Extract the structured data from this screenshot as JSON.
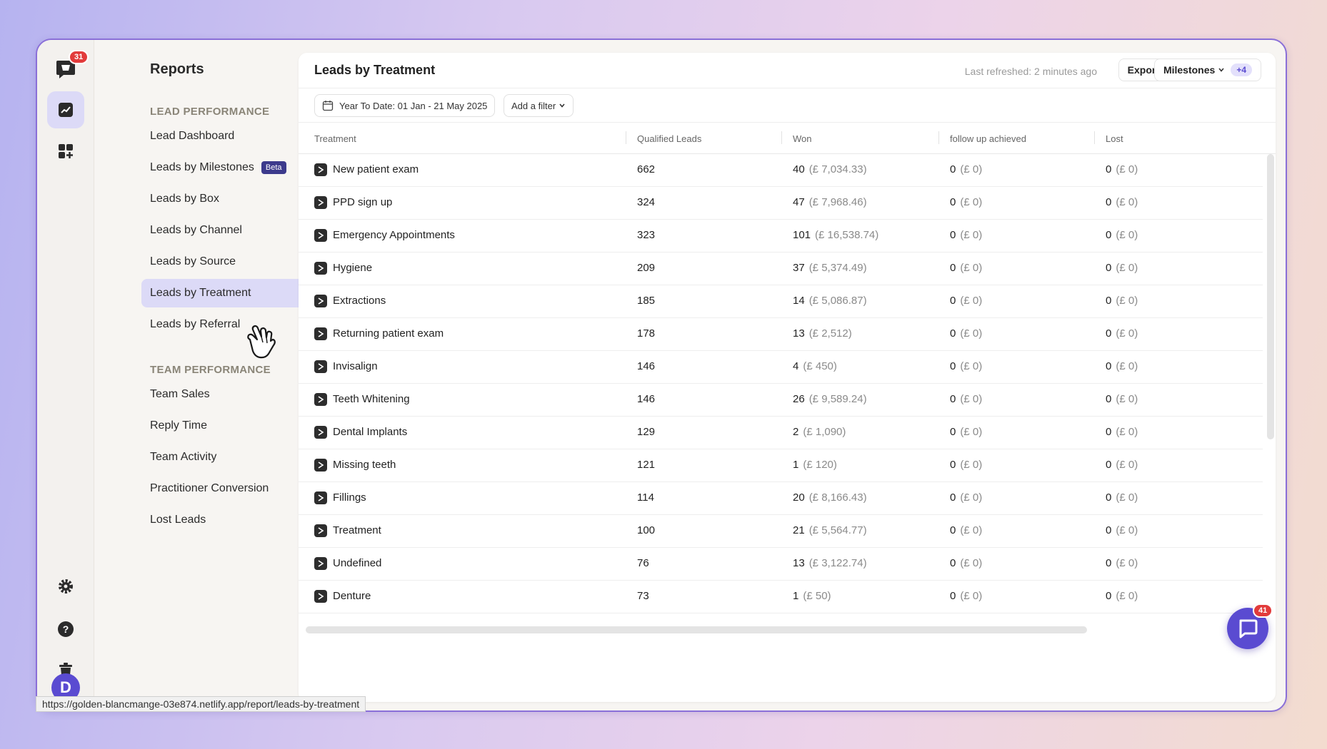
{
  "rail": {
    "app_badge": "31"
  },
  "avatar_letter": "D",
  "sidebar": {
    "title": "Reports",
    "lead_section": "LEAD PERFORMANCE",
    "lead_items": [
      {
        "label": "Lead Dashboard"
      },
      {
        "label": "Leads by Milestones",
        "badge": "Beta"
      },
      {
        "label": "Leads by Box"
      },
      {
        "label": "Leads by Channel"
      },
      {
        "label": "Leads by Source"
      },
      {
        "label": "Leads by Treatment",
        "active": true
      },
      {
        "label": "Leads by Referral"
      }
    ],
    "team_section": "TEAM PERFORMANCE",
    "team_items": [
      {
        "label": "Team Sales"
      },
      {
        "label": "Reply Time"
      },
      {
        "label": "Team Activity"
      },
      {
        "label": "Practitioner Conversion"
      },
      {
        "label": "Lost Leads"
      }
    ]
  },
  "header": {
    "title": "Leads by Treatment",
    "last_refreshed": "Last refreshed: 2 minutes ago",
    "export_label": "Export",
    "milestones_label": "Milestones",
    "milestones_extra": "+4"
  },
  "filters": {
    "date_range": "Year To Date: 01 Jan - 21 May 2025",
    "add_filter": "Add a filter"
  },
  "table": {
    "columns": [
      "Treatment",
      "Qualified Leads",
      "Won",
      "follow up achieved",
      "Lost"
    ],
    "rows": [
      {
        "treatment": "New patient exam",
        "qualified": "662",
        "won": "40",
        "won_value": "(£ 7,034.33)",
        "follow": "0",
        "follow_value": "(£ 0)",
        "lost": "0",
        "lost_value": "(£ 0)"
      },
      {
        "treatment": "PPD sign up",
        "qualified": "324",
        "won": "47",
        "won_value": "(£ 7,968.46)",
        "follow": "0",
        "follow_value": "(£ 0)",
        "lost": "0",
        "lost_value": "(£ 0)"
      },
      {
        "treatment": "Emergency Appointments",
        "qualified": "323",
        "won": "101",
        "won_value": "(£ 16,538.74)",
        "follow": "0",
        "follow_value": "(£ 0)",
        "lost": "0",
        "lost_value": "(£ 0)"
      },
      {
        "treatment": "Hygiene",
        "qualified": "209",
        "won": "37",
        "won_value": "(£ 5,374.49)",
        "follow": "0",
        "follow_value": "(£ 0)",
        "lost": "0",
        "lost_value": "(£ 0)"
      },
      {
        "treatment": "Extractions",
        "qualified": "185",
        "won": "14",
        "won_value": "(£ 5,086.87)",
        "follow": "0",
        "follow_value": "(£ 0)",
        "lost": "0",
        "lost_value": "(£ 0)"
      },
      {
        "treatment": "Returning patient exam",
        "qualified": "178",
        "won": "13",
        "won_value": "(£ 2,512)",
        "follow": "0",
        "follow_value": "(£ 0)",
        "lost": "0",
        "lost_value": "(£ 0)"
      },
      {
        "treatment": "Invisalign",
        "qualified": "146",
        "won": "4",
        "won_value": "(£ 450)",
        "follow": "0",
        "follow_value": "(£ 0)",
        "lost": "0",
        "lost_value": "(£ 0)"
      },
      {
        "treatment": "Teeth Whitening",
        "qualified": "146",
        "won": "26",
        "won_value": "(£ 9,589.24)",
        "follow": "0",
        "follow_value": "(£ 0)",
        "lost": "0",
        "lost_value": "(£ 0)"
      },
      {
        "treatment": "Dental Implants",
        "qualified": "129",
        "won": "2",
        "won_value": "(£ 1,090)",
        "follow": "0",
        "follow_value": "(£ 0)",
        "lost": "0",
        "lost_value": "(£ 0)"
      },
      {
        "treatment": "Missing teeth",
        "qualified": "121",
        "won": "1",
        "won_value": "(£ 120)",
        "follow": "0",
        "follow_value": "(£ 0)",
        "lost": "0",
        "lost_value": "(£ 0)"
      },
      {
        "treatment": "Fillings",
        "qualified": "114",
        "won": "20",
        "won_value": "(£ 8,166.43)",
        "follow": "0",
        "follow_value": "(£ 0)",
        "lost": "0",
        "lost_value": "(£ 0)"
      },
      {
        "treatment": "Treatment",
        "qualified": "100",
        "won": "21",
        "won_value": "(£ 5,564.77)",
        "follow": "0",
        "follow_value": "(£ 0)",
        "lost": "0",
        "lost_value": "(£ 0)"
      },
      {
        "treatment": "Undefined",
        "qualified": "76",
        "won": "13",
        "won_value": "(£ 3,122.74)",
        "follow": "0",
        "follow_value": "(£ 0)",
        "lost": "0",
        "lost_value": "(£ 0)"
      },
      {
        "treatment": "Denture",
        "qualified": "73",
        "won": "1",
        "won_value": "(£ 50)",
        "follow": "0",
        "follow_value": "(£ 0)",
        "lost": "0",
        "lost_value": "(£ 0)"
      }
    ]
  },
  "chat": {
    "badge": "41"
  },
  "status_url": "https://golden-blancmange-03e874.netlify.app/report/leads-by-treatment",
  "colors": {
    "accent": "#5a4bd1",
    "active_bg": "#dcdaf7",
    "badge_red": "#e23b3b"
  }
}
